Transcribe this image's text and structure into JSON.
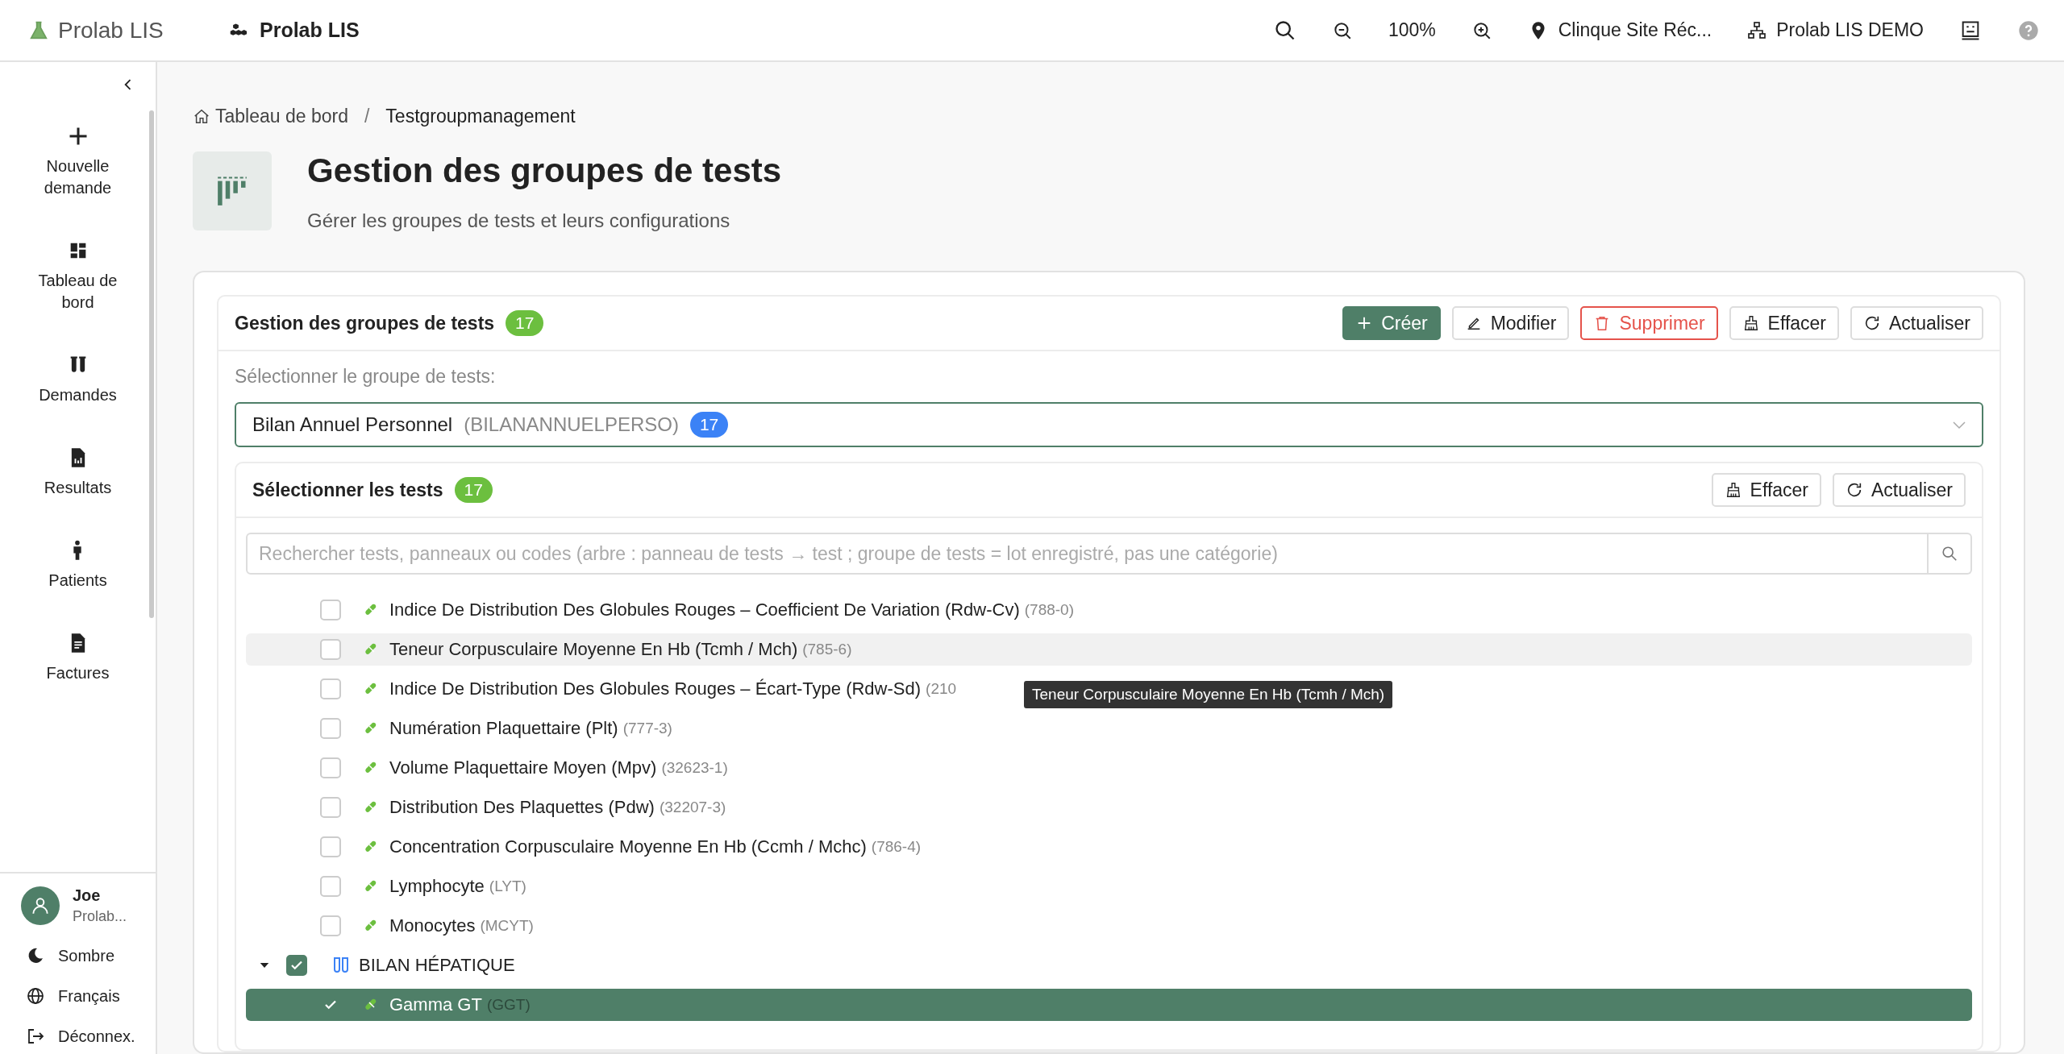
{
  "topbar": {
    "logo_text": "Prolab LIS",
    "workspace": "Prolab LIS",
    "zoom": "100%",
    "site": "Clinque Site Réc...",
    "organization": "Prolab LIS DEMO"
  },
  "sidebar": {
    "nav": [
      {
        "kind": "new",
        "label": "Nouvelle demande"
      },
      {
        "kind": "dashboard",
        "label": "Tableau de bord"
      },
      {
        "kind": "requests",
        "label": "Demandes"
      },
      {
        "kind": "results",
        "label": "Resultats"
      },
      {
        "kind": "patients",
        "label": "Patients"
      },
      {
        "kind": "invoices",
        "label": "Factures"
      }
    ],
    "user": {
      "name": "Joe",
      "org": "Prolab..."
    },
    "footer": [
      {
        "kind": "theme",
        "label": "Sombre"
      },
      {
        "kind": "language",
        "label": "Français"
      },
      {
        "kind": "logout",
        "label": "Déconnex."
      }
    ]
  },
  "breadcrumb_separator": "/",
  "breadcrumb": [
    {
      "kind": "home",
      "label": "Tableau de bord"
    },
    {
      "kind": "current",
      "label": "Testgroupmanagement"
    }
  ],
  "header": {
    "title": "Gestion des groupes de tests",
    "subtitle": "Gérer les groupes de tests et leurs configurations"
  },
  "panel": {
    "title": "Gestion des groupes de tests",
    "count": "17",
    "actions": [
      {
        "kind": "create",
        "label": "Créer"
      },
      {
        "kind": "edit",
        "label": "Modifier"
      },
      {
        "kind": "delete",
        "label": "Supprimer"
      },
      {
        "kind": "clear",
        "label": "Effacer"
      },
      {
        "kind": "refresh",
        "label": "Actualiser"
      }
    ],
    "select_label": "Sélectionner le groupe de tests:",
    "select": {
      "value": "Bilan Annuel Personnel",
      "code": "(BILANANNUELPERSO)",
      "count": "17"
    }
  },
  "tests": {
    "title": "Sélectionner les tests",
    "count": "17",
    "actions": [
      {
        "kind": "clear",
        "label": "Effacer"
      },
      {
        "kind": "refresh",
        "label": "Actualiser"
      }
    ],
    "search": {
      "placeholder": "Rechercher tests, panneaux ou codes (arbre : panneau de tests → test ; groupe de tests = lot enregistré, pas une catégorie)"
    },
    "rows": [
      {
        "label": "Indice De Distribution Des Globules Rouges – Coefficient De Variation (Rdw-Cv)",
        "code": "(788-0)",
        "checked": false,
        "hovered": false
      },
      {
        "label": "Teneur Corpusculaire Moyenne En Hb (Tcmh / Mch)",
        "code": "(785-6)",
        "checked": false,
        "hovered": true
      },
      {
        "label": "Indice De Distribution Des Globules Rouges – Écart-Type (Rdw-Sd)",
        "code": "(210",
        "checked": false,
        "hovered": false
      },
      {
        "label": "Numération Plaquettaire (Plt)",
        "code": "(777-3)",
        "checked": false,
        "hovered": false
      },
      {
        "label": "Volume Plaquettaire Moyen (Mpv)",
        "code": "(32623-1)",
        "checked": false,
        "hovered": false
      },
      {
        "label": "Distribution Des Plaquettes (Pdw)",
        "code": "(32207-3)",
        "checked": false,
        "hovered": false
      },
      {
        "label": "Concentration Corpusculaire Moyenne En Hb (Ccmh / Mchc)",
        "code": "(786-4)",
        "checked": false,
        "hovered": false
      },
      {
        "label": "Lymphocyte",
        "code": "(LYT)",
        "checked": false,
        "hovered": false
      },
      {
        "label": "Monocytes",
        "code": "(MCYT)",
        "checked": false,
        "hovered": false
      }
    ],
    "groups": [
      {
        "label": "BILAN HÉPATIQUE",
        "expanded": true,
        "checked": true,
        "children": [
          {
            "label": "Gamma GT",
            "code": "(GGT)",
            "checked": true
          }
        ]
      }
    ],
    "tooltip": "Teneur Corpusculaire Moyenne En Hb (Tcmh / Mch)"
  }
}
